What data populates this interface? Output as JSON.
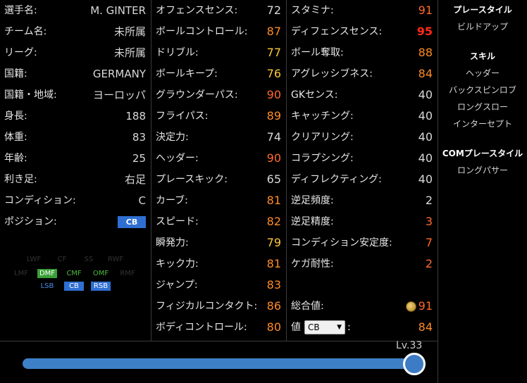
{
  "profile": [
    {
      "label": "選手名:",
      "value": "M. GINTER"
    },
    {
      "label": "チーム名:",
      "value": "未所属"
    },
    {
      "label": "リーグ:",
      "value": "未所属"
    },
    {
      "label": "国籍:",
      "value": "GERMANY"
    },
    {
      "label": "国籍・地域:",
      "value": "ヨーロッパ"
    },
    {
      "label": "身長:",
      "value": "188"
    },
    {
      "label": "体重:",
      "value": "83"
    },
    {
      "label": "年齢:",
      "value": "25"
    },
    {
      "label": "利き足:",
      "value": "右足"
    },
    {
      "label": "コンディション:",
      "value": "C"
    },
    {
      "label": "ポジション:",
      "value": "CB"
    }
  ],
  "position_map": {
    "row1": [
      "LWF",
      "CF",
      "SS",
      "RWF"
    ],
    "row2": [
      "LMF",
      "DMF",
      "CMF",
      "OMF",
      "RMF"
    ],
    "row3": [
      "LSB",
      "CB",
      "RSB"
    ]
  },
  "stats_mid": [
    {
      "label": "オフェンスセンス:",
      "value": "72",
      "color": "white"
    },
    {
      "label": "ボールコントロール:",
      "value": "87",
      "color": "orange"
    },
    {
      "label": "ドリブル:",
      "value": "77",
      "color": "yellow"
    },
    {
      "label": "ボールキープ:",
      "value": "76",
      "color": "yellow"
    },
    {
      "label": "グラウンダーパス:",
      "value": "90",
      "color": "dorange"
    },
    {
      "label": "フライパス:",
      "value": "89",
      "color": "orange"
    },
    {
      "label": "決定力:",
      "value": "74",
      "color": "white"
    },
    {
      "label": "ヘッダー:",
      "value": "90",
      "color": "dorange"
    },
    {
      "label": "プレースキック:",
      "value": "65",
      "color": "white"
    },
    {
      "label": "カーブ:",
      "value": "81",
      "color": "orange"
    },
    {
      "label": "スピード:",
      "value": "82",
      "color": "orange"
    },
    {
      "label": "瞬発力:",
      "value": "79",
      "color": "yellow"
    },
    {
      "label": "キック力:",
      "value": "81",
      "color": "orange"
    },
    {
      "label": "ジャンプ:",
      "value": "83",
      "color": "orange"
    },
    {
      "label": "フィジカルコンタクト:",
      "value": "86",
      "color": "orange"
    },
    {
      "label": "ボディコントロール:",
      "value": "80",
      "color": "orange"
    }
  ],
  "stats_right": [
    {
      "label": "スタミナ:",
      "value": "91",
      "color": "dorange"
    },
    {
      "label": "ディフェンスセンス:",
      "value": "95",
      "color": "red"
    },
    {
      "label": "ボール奪取:",
      "value": "88",
      "color": "orange"
    },
    {
      "label": "アグレッシブネス:",
      "value": "84",
      "color": "orange"
    },
    {
      "label": "GKセンス:",
      "value": "40",
      "color": "white"
    },
    {
      "label": "キャッチング:",
      "value": "40",
      "color": "white"
    },
    {
      "label": "クリアリング:",
      "value": "40",
      "color": "white"
    },
    {
      "label": "コラプシング:",
      "value": "40",
      "color": "white"
    },
    {
      "label": "ディフレクティング:",
      "value": "40",
      "color": "white"
    },
    {
      "label": "逆足頻度:",
      "value": "2",
      "color": "white"
    },
    {
      "label": "逆足精度:",
      "value": "3",
      "color": "dorange"
    },
    {
      "label": "コンディション安定度:",
      "value": "7",
      "color": "dorange"
    },
    {
      "label": "ケガ耐性:",
      "value": "2",
      "color": "dorange"
    }
  ],
  "overall": {
    "label": "総合値:",
    "value": "91"
  },
  "position_value": {
    "prefix": "値",
    "selected": "CB",
    "suffix": ":",
    "value": "84"
  },
  "sidebar": {
    "playstyle_title": "プレースタイル",
    "playstyle": "ビルドアップ",
    "skills_title": "スキル",
    "skills": [
      "ヘッダー",
      "バックスピンロブ",
      "ロングスロー",
      "インターセプト"
    ],
    "com_title": "COMプレースタイル",
    "com": [
      "ロングパサー"
    ]
  },
  "level": {
    "label": "Lv.33",
    "fraction": 1.0
  },
  "colors": {
    "accent_blue": "#2f6fd2",
    "green": "#39a035"
  }
}
